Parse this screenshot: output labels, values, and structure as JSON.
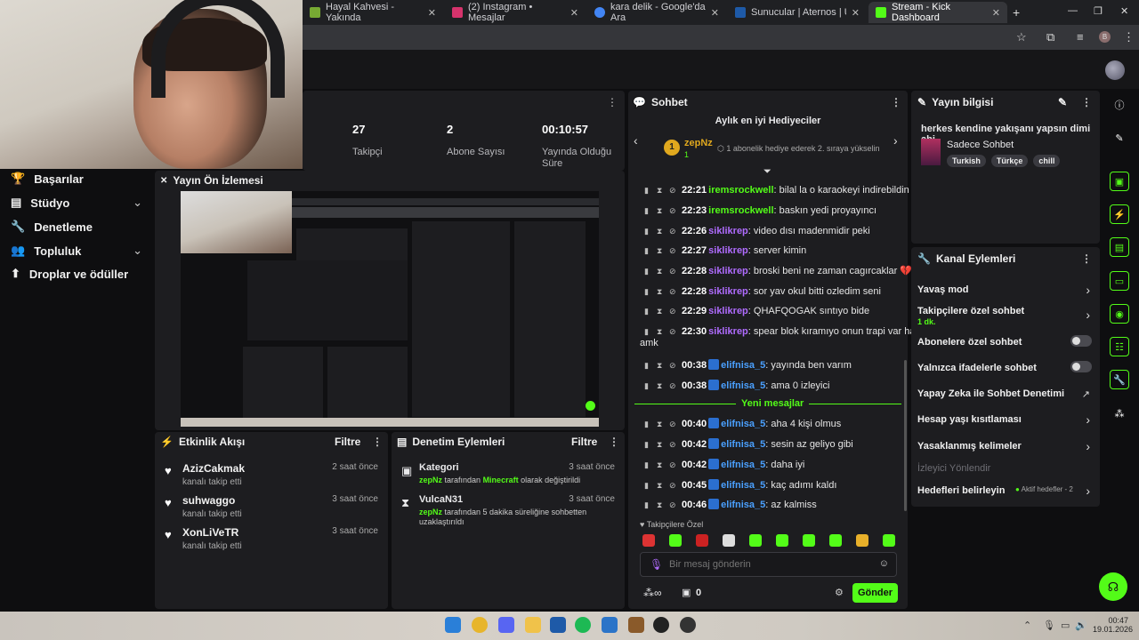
{
  "tabs": [
    {
      "label": "Hayal Kahvesi - Yakında",
      "fav": "#7a3"
    },
    {
      "label": "(2) Instagram • Mesajlar",
      "fav": "#d6336c"
    },
    {
      "label": "kara delik - Google'da Ara",
      "fav": "#4285f4"
    },
    {
      "label": "Sunucular | Aternos | Ücretsiz M",
      "fav": "#1e5aa8"
    },
    {
      "label": "Stream - Kick Dashboard",
      "fav": "#53fc18"
    }
  ],
  "window": {
    "minimize": "—",
    "maximize": "❐",
    "close": "✕",
    "new_tab": "+"
  },
  "addr": {
    "star": "☆",
    "profile": "B",
    "menu": "⋮"
  },
  "stats": [
    {
      "value": "27",
      "label": "Takipçi"
    },
    {
      "value": "2",
      "label": "Abone Sayısı"
    },
    {
      "value": "00:10:57",
      "label": "Yayında Olduğu Süre"
    }
  ],
  "sidebar": {
    "items": [
      {
        "label": "Başarılar",
        "icon": "trophy-icon"
      },
      {
        "label": "Stüdyo",
        "icon": "studio-icon",
        "chev": "⌄"
      },
      {
        "label": "Denetleme",
        "icon": "wrench-icon"
      },
      {
        "label": "Topluluk",
        "icon": "community-icon",
        "chev": "⌄"
      },
      {
        "label": "Droplar ve ödüller",
        "icon": "drops-icon"
      }
    ]
  },
  "preview": {
    "title": "Yayın Ön İzlemesi"
  },
  "activity": {
    "title": "Etkinlik Akışı",
    "filter": "Filtre",
    "items": [
      {
        "name": "AzizCakmak",
        "sub": "kanalı takip etti",
        "time": "2 saat önce"
      },
      {
        "name": "suhwaggo",
        "sub": "kanalı takip etti",
        "time": "3 saat önce"
      },
      {
        "name": "XonLiVeTR",
        "sub": "kanalı takip etti",
        "time": "3 saat önce"
      }
    ]
  },
  "modlog": {
    "title": "Denetim Eylemleri",
    "filter": "Filtre",
    "items": [
      {
        "name": "Kategori",
        "actor": "zepNz",
        "text1": " tarafından ",
        "hl": "Minecraft",
        "text2": " olarak değiştirildi",
        "time": "3 saat önce"
      },
      {
        "name": "VulcaN31",
        "actor": "zepNz",
        "text1": " tarafından 5 dakika süreliğine sohbetten uzaklaştırıldı",
        "hl": "",
        "text2": "",
        "time": "3 saat önce"
      }
    ]
  },
  "chat": {
    "title": "Sohbet",
    "gifters_title": "Aylık en iyi Hediyeciler",
    "gifter_name": "zepNz",
    "gifter_count": "1",
    "gifter_rank": "1",
    "gifter_hint": "1 abonelik hediye ederek 2. sıraya yükselin",
    "new_messages": "Yeni mesajlar",
    "messages": [
      {
        "time": "22:21",
        "user": "iremsrockwell",
        "color": "#53fc18",
        "text": "bilal la o karaokeyi indirebildin mi sen",
        "kick": false
      },
      {
        "time": "22:23",
        "user": "iremsrockwell",
        "color": "#53fc18",
        "text": "baskın yedi proyayıncı",
        "kick": false
      },
      {
        "time": "22:26",
        "user": "siklikrep",
        "color": "#b06cff",
        "text": "video dısı madenmidir peki",
        "kick": false
      },
      {
        "time": "22:27",
        "user": "siklikrep",
        "color": "#b06cff",
        "text": "server kimin",
        "kick": false
      },
      {
        "time": "22:28",
        "user": "siklikrep",
        "color": "#b06cff",
        "text": "broski beni ne zaman cagırcaklar 💔",
        "kick": false
      },
      {
        "time": "22:28",
        "user": "siklikrep",
        "color": "#b06cff",
        "text": "sor yav okul bitti ozledim seni",
        "kick": false
      },
      {
        "time": "22:29",
        "user": "siklikrep",
        "color": "#b06cff",
        "text": "QHAFQOGAK sıntıyo bide",
        "kick": false
      },
      {
        "time": "22:30",
        "user": "siklikrep",
        "color": "#b06cff",
        "text": "spear blok kıramıyo onun trapi var hatta",
        "cont": "amk",
        "kick": false
      },
      {
        "time": "00:38",
        "user": "elifnisa_5",
        "color": "#4aa0ff",
        "text": "yayında ben varım",
        "kick": true
      },
      {
        "time": "00:38",
        "user": "elifnisa_5",
        "color": "#4aa0ff",
        "text": "ama 0 izleyici",
        "kick": true
      },
      {
        "time": "00:40",
        "user": "elifnisa_5",
        "color": "#4aa0ff",
        "text": "aha 4 kişi olmus",
        "kick": true
      },
      {
        "time": "00:42",
        "user": "elifnisa_5",
        "color": "#4aa0ff",
        "text": "sesin az geliyo gibi",
        "kick": true
      },
      {
        "time": "00:42",
        "user": "elifnisa_5",
        "color": "#4aa0ff",
        "text": "daha iyi",
        "kick": true
      },
      {
        "time": "00:45",
        "user": "elifnisa_5",
        "color": "#4aa0ff",
        "text": "kaç adımı kaldı",
        "kick": true
      },
      {
        "time": "00:46",
        "user": "elifnisa_5",
        "color": "#4aa0ff",
        "text": "az kalmiss",
        "kick": true
      }
    ],
    "followers_only": "Takipçilere Özel",
    "input_placeholder": "Bir mesaj gönderin",
    "points": "0",
    "send": "Gönder"
  },
  "stream_info": {
    "title": "Yayın bilgisi",
    "stream_title": "herkes kendine yakışanı yapsın dimi abi",
    "category": "Sadece Sohbet",
    "tags": [
      "Turkish",
      "Türkçe",
      "chill"
    ]
  },
  "channel_actions": {
    "title": "Kanal Eylemleri",
    "items": [
      {
        "label": "Yavaş mod",
        "type": "arrow"
      },
      {
        "label": "Takipçilere özel sohbet",
        "sub": "1 dk.",
        "type": "arrow"
      },
      {
        "label": "Abonelere özel sohbet",
        "type": "toggle"
      },
      {
        "label": "Yalnızca ifadelerle sohbet",
        "type": "toggle"
      },
      {
        "label": "Yapay Zeka ile Sohbet Denetimi",
        "type": "ext"
      },
      {
        "label": "Hesap yaşı kısıtlaması",
        "type": "arrow"
      },
      {
        "label": "Yasaklanmış kelimeler",
        "type": "arrow"
      },
      {
        "label": "İzleyici Yönlendir",
        "type": "disabled"
      },
      {
        "label": "Hedefleri belirleyin",
        "badge": "Aktif hedefler - 2",
        "type": "arrow"
      }
    ]
  },
  "taskbar": {
    "time": "00:47",
    "date": "19.01.2026"
  },
  "colors": {
    "accent": "#53fc18",
    "panel": "#1d1d20",
    "bg": "#0e0e10"
  }
}
